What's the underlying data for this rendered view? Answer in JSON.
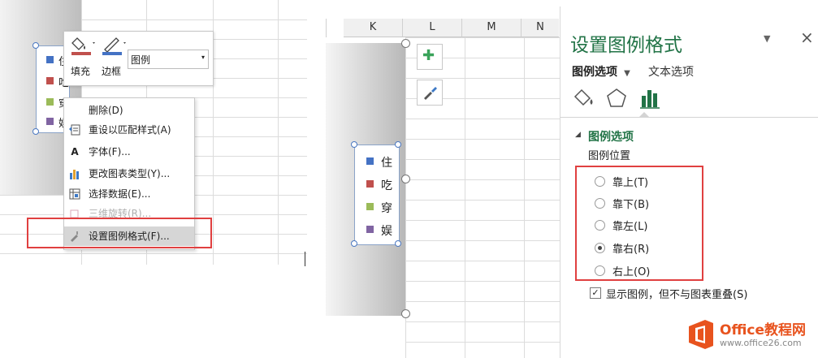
{
  "left": {
    "legend_items": [
      {
        "label": "住",
        "color": "#4472c4"
      },
      {
        "label": "吃",
        "color": "#c0504d"
      },
      {
        "label": "穿",
        "color": "#9bbb59"
      },
      {
        "label": "娱",
        "color": "#8064a2"
      }
    ],
    "mini_toolbar": {
      "fill_label": "填充",
      "border_label": "边框",
      "element_select_value": "图例",
      "fill_color": "#c0504d",
      "border_color": "#4472c4"
    },
    "context_menu": {
      "items": [
        {
          "label": "删除(D)",
          "icon": "",
          "disabled": false
        },
        {
          "label": "重设以匹配样式(A)",
          "icon": "reset-style-icon",
          "disabled": false
        },
        {
          "label": "字体(F)...",
          "icon": "font-icon",
          "disabled": false
        },
        {
          "label": "更改图表类型(Y)...",
          "icon": "chart-type-icon",
          "disabled": false
        },
        {
          "label": "选择数据(E)...",
          "icon": "select-data-icon",
          "disabled": false
        },
        {
          "label": "三维旋转(R)...",
          "icon": "3d-rotation-icon",
          "disabled": true
        },
        {
          "label": "设置图例格式(F)...",
          "icon": "format-legend-icon",
          "disabled": false,
          "highlighted": true
        }
      ]
    },
    "font_glyph": "A",
    "accent_red": "#e04040"
  },
  "right": {
    "columns": [
      "K",
      "L",
      "M",
      "N"
    ],
    "legend_items": [
      {
        "label": "住",
        "color": "#4472c4"
      },
      {
        "label": "吃",
        "color": "#c0504d"
      },
      {
        "label": "穿",
        "color": "#9bbb59"
      },
      {
        "label": "娱",
        "color": "#8064a2"
      }
    ],
    "side_buttons": {
      "add_glyph": "✚",
      "style_glyph": "🖌"
    },
    "pane": {
      "title": "设置图例格式",
      "tab_legend_options": "图例选项",
      "tab_text_options": "文本选项",
      "section_title": "图例选项",
      "position_label": "图例位置",
      "positions": [
        {
          "label": "靠上(T)",
          "selected": false
        },
        {
          "label": "靠下(B)",
          "selected": false
        },
        {
          "label": "靠左(L)",
          "selected": false
        },
        {
          "label": "靠右(R)",
          "selected": true
        },
        {
          "label": "右上(O)",
          "selected": false
        }
      ],
      "show_legend_no_overlap": "显示图例，但不与图表重叠(S)",
      "show_legend_checked": true,
      "close_glyph": "×",
      "dropdown_glyph": "▼",
      "collapse_glyph": "◢",
      "check_glyph": "✓",
      "accent_green": "#217346"
    },
    "watermark": {
      "brand": "Office教程网",
      "url": "www.office26.com"
    }
  }
}
